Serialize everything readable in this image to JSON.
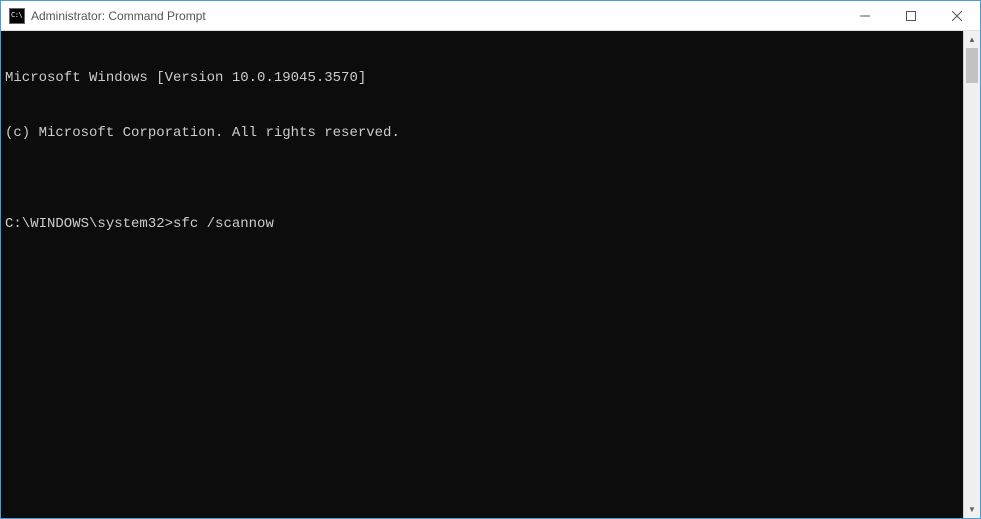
{
  "titlebar": {
    "icon_text": "C:\\",
    "title": "Administrator: Command Prompt"
  },
  "terminal": {
    "line1": "Microsoft Windows [Version 10.0.19045.3570]",
    "line2": "(c) Microsoft Corporation. All rights reserved.",
    "blank": "",
    "prompt": "C:\\WINDOWS\\system32>",
    "command": "sfc /scannow"
  },
  "scrollbar": {
    "up": "▲",
    "down": "▼"
  }
}
